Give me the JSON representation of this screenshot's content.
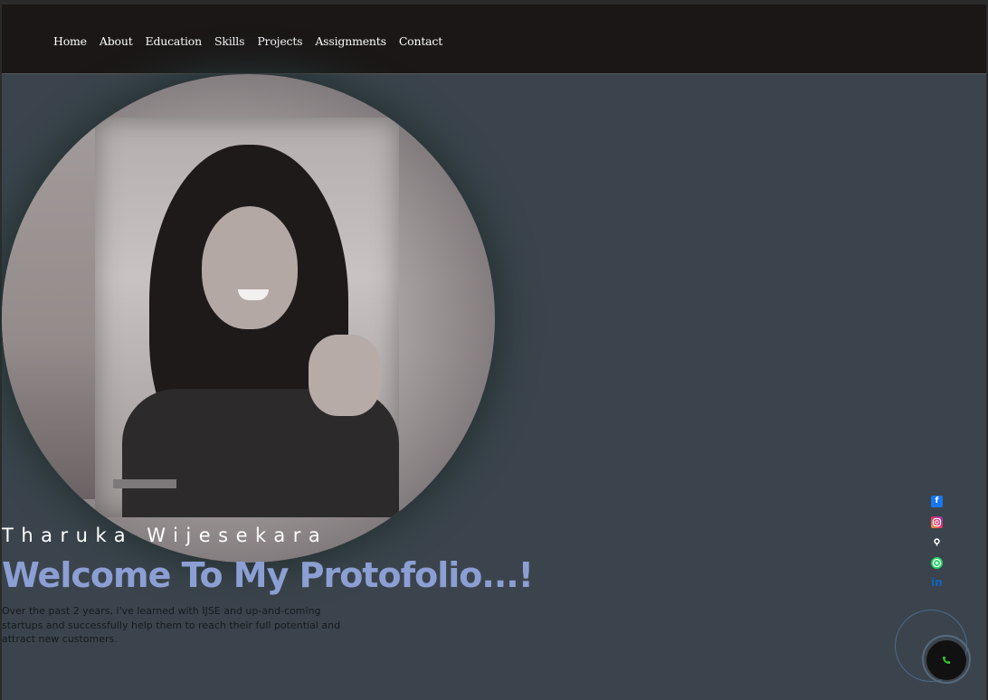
{
  "nav": {
    "items": [
      {
        "label": "Home"
      },
      {
        "label": "About"
      },
      {
        "label": "Education"
      },
      {
        "label": "Skills"
      },
      {
        "label": "Projects"
      },
      {
        "label": "Assignments"
      },
      {
        "label": "Contact"
      }
    ]
  },
  "hero": {
    "name": "Tharuka Wijesekara",
    "welcome": "Welcome To My Protofolio...!",
    "intro": "Over the past 2 years, i've learned with IJSE and up-and-coming startups and successfully help them to reach their full potential and attract new customers."
  },
  "social": {
    "icons": [
      "facebook-icon",
      "instagram-icon",
      "github-icon",
      "whatsapp-icon",
      "linkedin-icon"
    ],
    "linkedin_text": "in"
  },
  "call": {
    "icon": "phone-icon"
  },
  "colors": {
    "navbar_bg": "#1b1717",
    "main_bg": "#3b444c",
    "accent_title": "#8c9fd4",
    "facebook": "#1877f2",
    "whatsapp": "#25d366",
    "linkedin": "#0a66c2",
    "phone_green": "#33cc33"
  }
}
